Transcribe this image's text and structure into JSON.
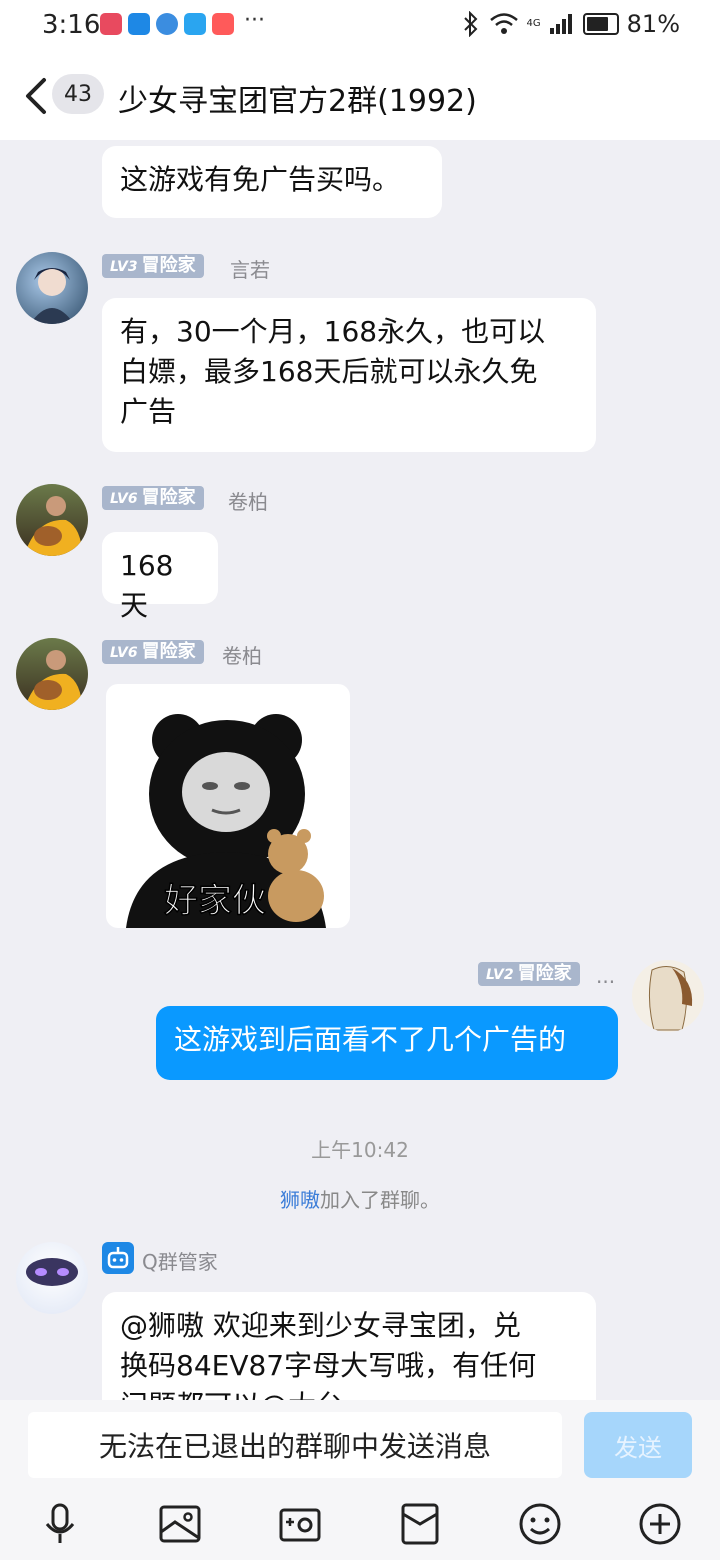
{
  "status_bar": {
    "time": "3:16",
    "more": "···",
    "network": "4G",
    "battery_pct": "81%",
    "battery_level": 0.81
  },
  "header": {
    "unread_count": "43",
    "title": "少女寻宝团官方2群(1992)"
  },
  "messages": {
    "m0": {
      "text": "这游戏有免广告买吗。"
    },
    "m1": {
      "level": "LV3",
      "role": "冒险家",
      "nick": "言若",
      "lines": [
        "有，30一个月，168永久，也可以",
        "白嫖，最多168天后就可以永久免",
        "广告"
      ]
    },
    "m2": {
      "level": "LV6",
      "role": "冒险家",
      "nick": "卷柏",
      "text": "168天"
    },
    "m3": {
      "level": "LV6",
      "role": "冒险家",
      "nick": "卷柏",
      "sticker_caption": "好家伙"
    },
    "m4": {
      "level": "LV2",
      "role": "冒险家",
      "nick": "...",
      "text": "这游戏到后面看不了几个广告的"
    },
    "timestamp": "上午10:42",
    "system": {
      "name": "狮嗷",
      "action": "加入了群聊。"
    },
    "m5": {
      "nick": "Q群管家",
      "lines": [
        "@狮嗷 欢迎来到少女寻宝团，兑",
        "换码84EV87字母大写哦，有任何",
        "问题都可以@大台"
      ]
    }
  },
  "input": {
    "placeholder": "无法在已退出的群聊中发送消息",
    "send_label": "发送"
  },
  "toolbar_icons": [
    "microphone-icon",
    "image-icon",
    "camera-icon",
    "red-packet-icon",
    "emoji-icon",
    "plus-icon"
  ],
  "colors": {
    "accent": "#0a99ff",
    "background": "#efeff4",
    "level_tag": "#a9b6cc"
  }
}
